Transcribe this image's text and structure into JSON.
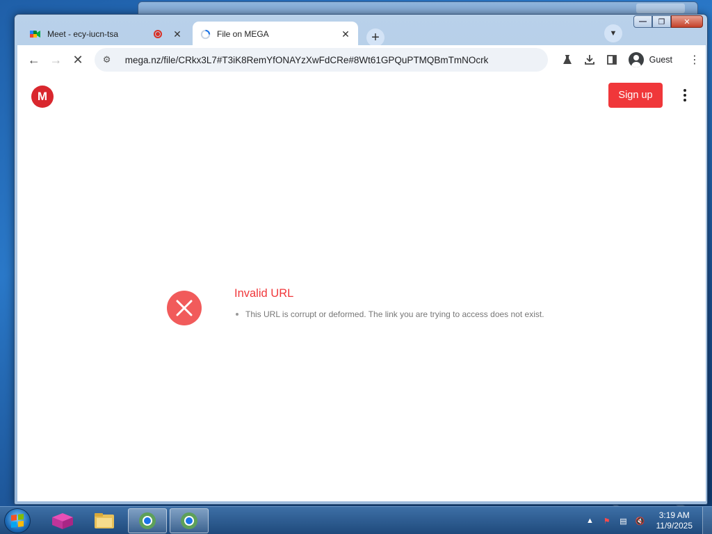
{
  "browser": {
    "tabs": [
      {
        "title": "Meet - ecy-iucn-tsa",
        "icon": "google-meet-icon",
        "recording": true
      },
      {
        "title": "File on MEGA",
        "icon": "loading-spinner-icon",
        "active": true
      }
    ],
    "address_bar": {
      "url": "mega.nz/file/CRkx3L7#T3iK8RemYfONAYzXwFdCRe#8Wt61GPQuPTMQBmTmNOcrk"
    },
    "profile": {
      "label": "Guest"
    }
  },
  "page": {
    "logo": {
      "letter": "M"
    },
    "header": {
      "signup_label": "Sign up"
    },
    "error": {
      "title": "Invalid URL",
      "message": "This URL is corrupt or deformed. The link you are trying to access does not exist."
    }
  },
  "taskbar": {
    "clock": {
      "time": "3:19 AM",
      "date": "11/9/2025"
    }
  },
  "colors": {
    "accent": "#f0373a",
    "mega_red": "#d9272e",
    "error_icon": "#f15b5b"
  }
}
